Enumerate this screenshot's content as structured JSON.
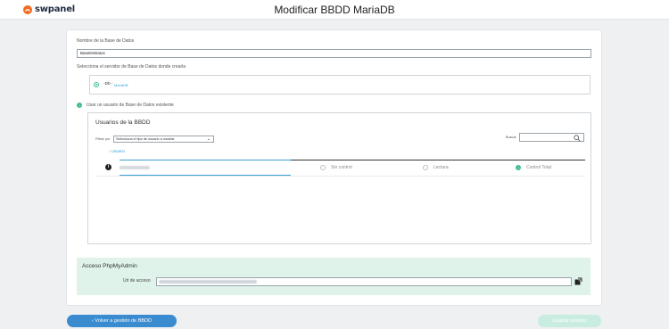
{
  "header": {
    "brand": "swpanel",
    "title": "Modificar BBDD MariaDB"
  },
  "form": {
    "db_name_label": "Nombre de la Base de Datos",
    "db_name_value": "BaseDeDatos",
    "server_label": "Selecciona el servidor de Base de Datos donde crearla",
    "server_option": {
      "name": "-Db -",
      "engine": "MariaDB",
      "selected": true
    },
    "existing_user_label": "Usar un usuario de Base de Datos existente",
    "existing_user_selected": true
  },
  "users": {
    "title": "Usuarios de la BBDD",
    "filter_label": "Filtrar por",
    "filter_value": "Selecciona el tipo de usuario a mostrar",
    "search_label": "Buscar",
    "search_value": "",
    "column_user": "Usuario",
    "sort_indicator": "↑",
    "rows": [
      {
        "name": "",
        "permission": "Control Total",
        "options": [
          "Sin control",
          "Lectura",
          "Control Total"
        ]
      }
    ]
  },
  "phpmyadmin": {
    "title": "Acceso PhpMyAdmin",
    "url_label": "Url de acceso",
    "url_value": ""
  },
  "actions": {
    "back_label": "Volver a gestión de BBDD",
    "back_icon": "chevron-left",
    "save_label": "Guardar cambios"
  },
  "colors": {
    "accent_green": "#3fbf8f",
    "accent_blue": "#3a8bd0",
    "brand_orange": "#f26a21",
    "panel_green_bg": "#dff3eb"
  }
}
